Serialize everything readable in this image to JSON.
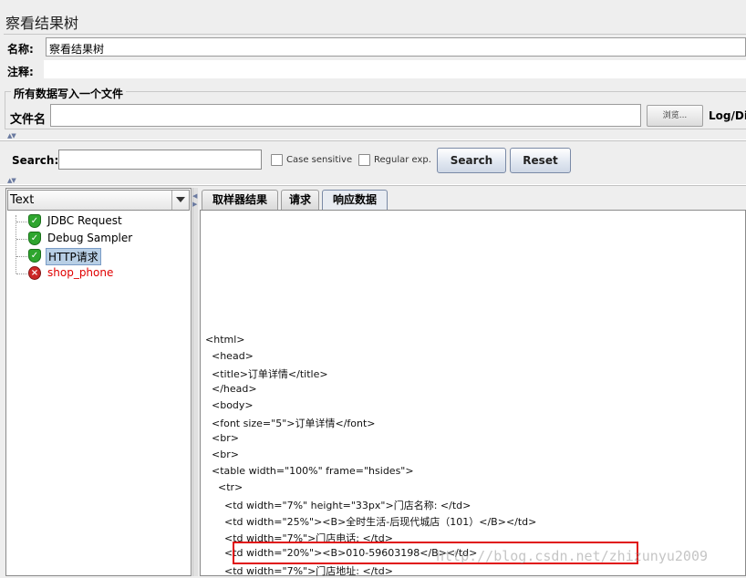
{
  "page_title": "察看结果树",
  "name": {
    "label": "名称:",
    "value": "察看结果树"
  },
  "comment": {
    "label": "注释:",
    "value": ""
  },
  "file_section": {
    "legend": "所有数据写入一个文件",
    "file_label": "文件名",
    "file_value": "",
    "browse_label": "浏览...",
    "log_label": "Log/Dis"
  },
  "search": {
    "label": "Search:",
    "value": "",
    "case_sensitive": "Case sensitive",
    "regular_exp": "Regular exp.",
    "search_button": "Search",
    "reset_button": "Reset"
  },
  "renderer": {
    "selected": "Text"
  },
  "tree": [
    {
      "label": "JDBC Request",
      "status": "success",
      "icon": "shield-check-icon"
    },
    {
      "label": "Debug Sampler",
      "status": "success",
      "icon": "shield-check-icon"
    },
    {
      "label": "HTTP请求",
      "status": "success",
      "icon": "shield-check-icon",
      "selected": true
    },
    {
      "label": "shop_phone",
      "status": "error",
      "icon": "shield-error-icon"
    }
  ],
  "tabs": [
    {
      "label": "取样器结果",
      "active": false
    },
    {
      "label": "请求",
      "active": false
    },
    {
      "label": "响应数据",
      "active": true
    }
  ],
  "response_lines": [
    "<html>",
    "  <head>",
    "  <title>订单详情</title>",
    "  </head>",
    "  <body>",
    "  <font size=\"5\">订单详情</font>",
    "  <br>",
    "  <br>",
    "  <table width=\"100%\" frame=\"hsides\">",
    "    <tr>",
    "      <td width=\"7%\" height=\"33px\">门店名称: </td>",
    "      <td width=\"25%\"><B>全时生活-后现代城店（101）</B></td>",
    "      <td width=\"7%\">门店电话: </td>",
    "      <td width=\"20%\"><B>010-59603198</B></td>",
    "      <td width=\"7%\">门店地址: </td>"
  ],
  "watermark": "http://blog.csdn.net/zhizunyu2009"
}
